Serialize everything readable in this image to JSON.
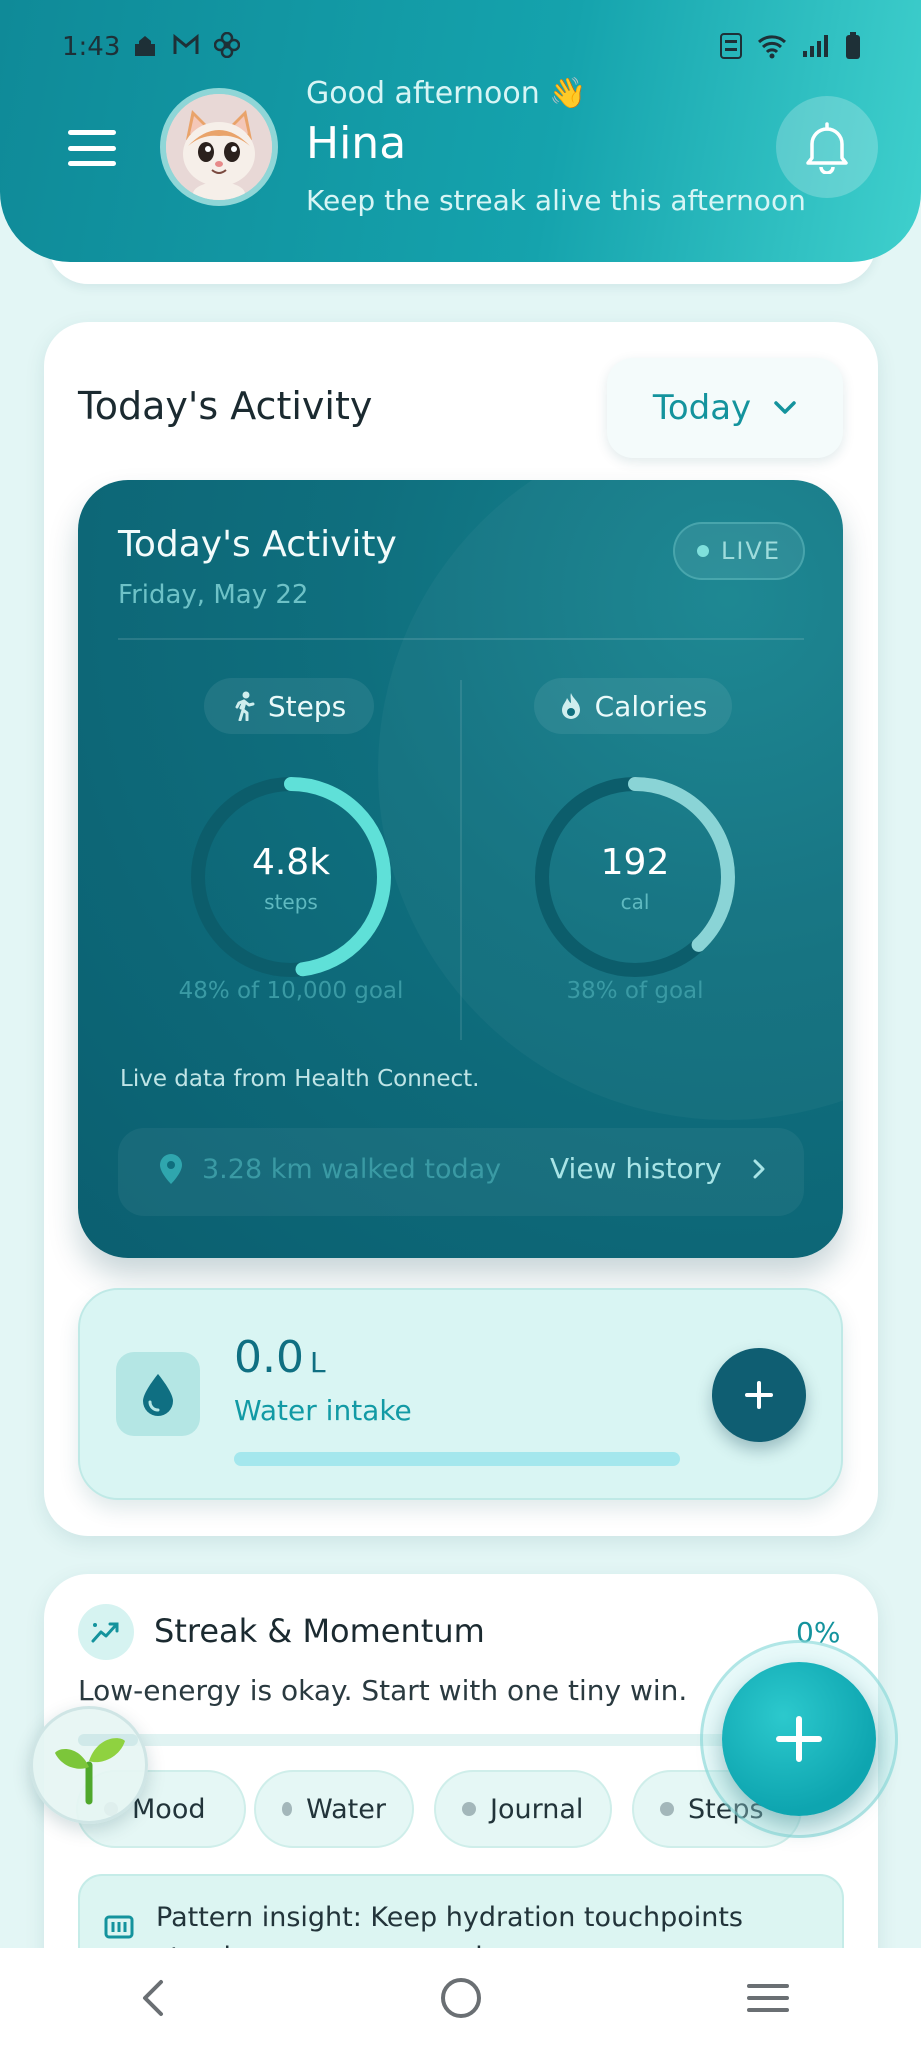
{
  "status_bar": {
    "time": "1:43"
  },
  "header": {
    "greeting": "Good afternoon 👋",
    "user_name": "Hina",
    "tagline": "Keep the streak alive this afternoon"
  },
  "activity_section": {
    "title": "Today's Activity",
    "period_selector": {
      "selected": "Today"
    }
  },
  "activity_card": {
    "title": "Today's Activity",
    "date": "Friday, May 22",
    "live_badge": "LIVE",
    "steps": {
      "label": "Steps",
      "value": "4.8k",
      "unit": "steps",
      "goal_text": "48% of 10,000 goal",
      "progress": 0.48
    },
    "calories": {
      "label": "Calories",
      "value": "192",
      "unit": "cal",
      "goal_text": "38% of goal",
      "progress": 0.38
    },
    "source_note": "Live data from Health Connect.",
    "distance": "3.28 km walked today",
    "view_history": "View history"
  },
  "water_card": {
    "value": "0.0",
    "unit": "L",
    "label": "Water intake",
    "progress": 0
  },
  "streak": {
    "title": "Streak & Momentum",
    "percent": "0%",
    "subtitle": "Low-energy is okay. Start with one tiny win.",
    "chips": [
      "Mood",
      "Water",
      "Journal",
      "Steps"
    ],
    "insight": "Pattern insight: Keep hydration touchpoints steady across your week."
  },
  "colors": {
    "header_start": "#0f8a98",
    "header_end": "#3fd0cd",
    "card_dark": "#0f6f7e",
    "accent": "#14939d",
    "ring_progress": "#5fe0d8"
  }
}
